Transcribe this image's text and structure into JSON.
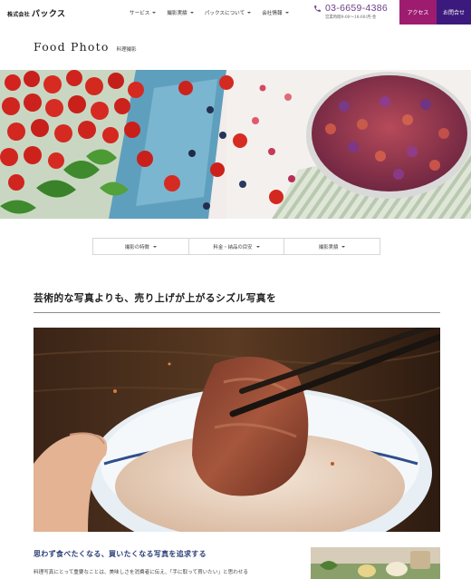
{
  "header": {
    "logo_sub": "株式会社",
    "logo_main": "パックス",
    "nav": [
      {
        "label": "サービス"
      },
      {
        "label": "撮影実績"
      },
      {
        "label": "パックスについて"
      },
      {
        "label": "会社情報"
      }
    ],
    "tel": "03-6659-4386",
    "hours": "営業時間9:00～18:00/月-金",
    "access_label": "アクセス",
    "contact_label": "お問合せ"
  },
  "page_title": {
    "en": "Food Photo",
    "ja": "料理撮影"
  },
  "subnav": [
    {
      "label": "撮影の特徴"
    },
    {
      "label": "料金・納品の目安"
    },
    {
      "label": "撮影実績"
    }
  ],
  "section": {
    "heading": "芸術的な写真よりも、売り上げが上がるシズル写真を",
    "sub_heading": "思わず食べたくなる、買いたくなる写真を追求する",
    "body": "料理写真にとって重要なことは、美味しさを消費者に伝え、「手に取って買いたい」と思わせる"
  },
  "colors": {
    "access_bg": "#9d1c70",
    "contact_bg": "#3c1a7d",
    "tel_color": "#6b3e8a",
    "sub_heading_color": "#2c3e78"
  },
  "icons": {
    "phone": "phone-icon",
    "nav_chevron": "chevron-down-icon"
  }
}
